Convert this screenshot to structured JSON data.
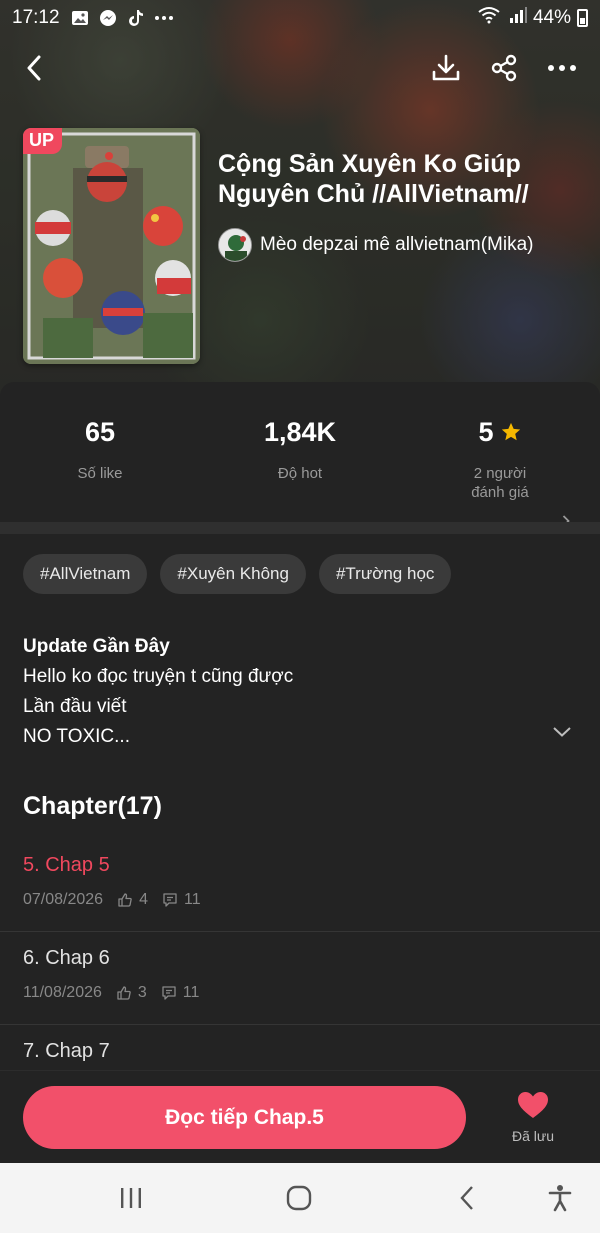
{
  "status": {
    "time": "17:12",
    "battery": "44%",
    "icons": [
      "gallery-icon",
      "messenger-icon",
      "tiktok-icon",
      "more-dots-icon"
    ]
  },
  "header": {
    "badge": "UP",
    "title": "Cộng Sản Xuyên Ko Giúp Nguyên Chủ //AllVietnam//",
    "author": "Mèo depzai mê allvietnam(Mika)"
  },
  "stats": {
    "likes_value": "65",
    "likes_label": "Số like",
    "hot_value": "1,84K",
    "hot_label": "Độ hot",
    "rating_value": "5",
    "rating_label": "2 người đánh giá"
  },
  "tags": [
    "#AllVietnam",
    "#Xuyên Không",
    "#Trường học"
  ],
  "update": {
    "title": "Update Gần Đây",
    "lines": [
      "Hello ko đọc truyện t cũng được",
      "Lần đầu viết",
      "NO TOXIC..."
    ]
  },
  "chapters": {
    "heading": "Chapter(17)",
    "items": [
      {
        "title": "5. Chap 5",
        "date": "07/08/2026",
        "likes": "4",
        "comments": "11"
      },
      {
        "title": "6. Chap 6",
        "date": "11/08/2026",
        "likes": "3",
        "comments": "11"
      },
      {
        "title": "7. Chap 7"
      }
    ]
  },
  "actions": {
    "read_label": "Đọc tiếp Chap.5",
    "saved_label": "Đã lưu"
  },
  "colors": {
    "accent": "#f2506a",
    "star": "#f5b800"
  }
}
